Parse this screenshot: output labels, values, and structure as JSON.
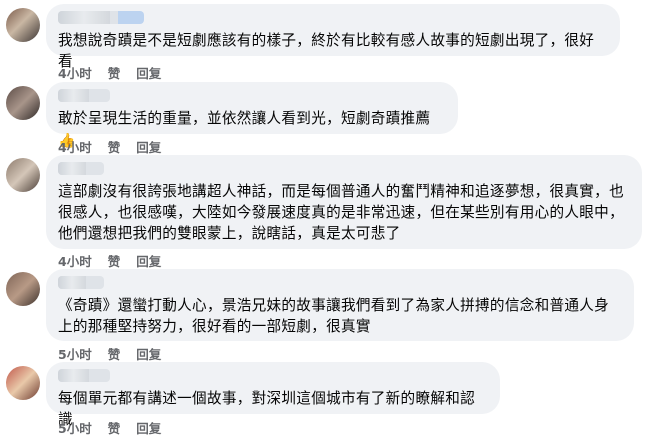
{
  "comments": [
    {
      "text": "我想說奇蹟是不是短劇應該有的樣子，終於有比較有感人故事的短劇出現了，很好看",
      "time": "4小时",
      "like": "赞",
      "reply": "回复",
      "avatar_colors": [
        "#7b5a4a",
        "#c9b7a3",
        "#3b3433"
      ]
    },
    {
      "text": "敢於呈現生活的重量，並依然讓人看到光，短劇奇蹟推薦",
      "emoji": "👍",
      "time": "4小时",
      "like": "赞",
      "reply": "回复",
      "avatar_colors": [
        "#5b4b45",
        "#a8958a",
        "#2d2726"
      ]
    },
    {
      "text": "這部劇沒有很誇張地講超人神話，而是每個普通人的奮鬥精神和追逐夢想，很真實，也很感人，也很感嘆，大陸如今發展速度真的是非常迅速，但在某些別有用心的人眼中，他們還想把我們的雙眼蒙上，說瞎話，真是太可悲了",
      "time": "4小时",
      "like": "赞",
      "reply": "回复",
      "avatar_colors": [
        "#8c7a6c",
        "#d4c6b8",
        "#4a3d36"
      ]
    },
    {
      "text": "《奇蹟》還蠻打動人心，景浩兄妹的故事讓我們看到了為家人拼搏的信念和普通人身上的那種堅持努力，很好看的一部短劇，很真實",
      "time": "5小时",
      "like": "赞",
      "reply": "回复",
      "avatar_colors": [
        "#7e6456",
        "#b89a86",
        "#3c302b"
      ]
    },
    {
      "text": "每個單元都有講述一個故事，對深圳這個城市有了新的瞭解和認識",
      "time": "5小时",
      "like": "赞",
      "reply": "回复",
      "avatar_colors": [
        "#c0564a",
        "#e9c9a9",
        "#6d3a2f"
      ]
    }
  ]
}
